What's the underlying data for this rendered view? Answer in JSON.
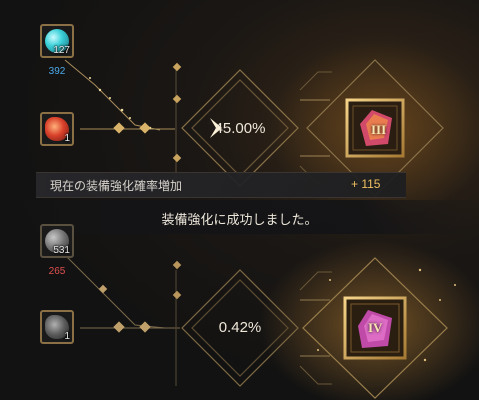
{
  "top": {
    "material1": {
      "count": "127",
      "owned": "392",
      "owned_color": "#4aa8e8"
    },
    "material2": {
      "count": "1"
    },
    "success_rate": "45.00%",
    "result_tier": "III"
  },
  "bonus_bar": {
    "label": "現在の装備強化確率増加",
    "value": "+ 115"
  },
  "toast": {
    "message": "装備強化に成功しました。"
  },
  "bottom": {
    "material1": {
      "count": "531",
      "owned": "265",
      "owned_color": "#e05050"
    },
    "material2": {
      "count": "1"
    },
    "success_rate": "0.42%",
    "result_tier": "IV"
  }
}
